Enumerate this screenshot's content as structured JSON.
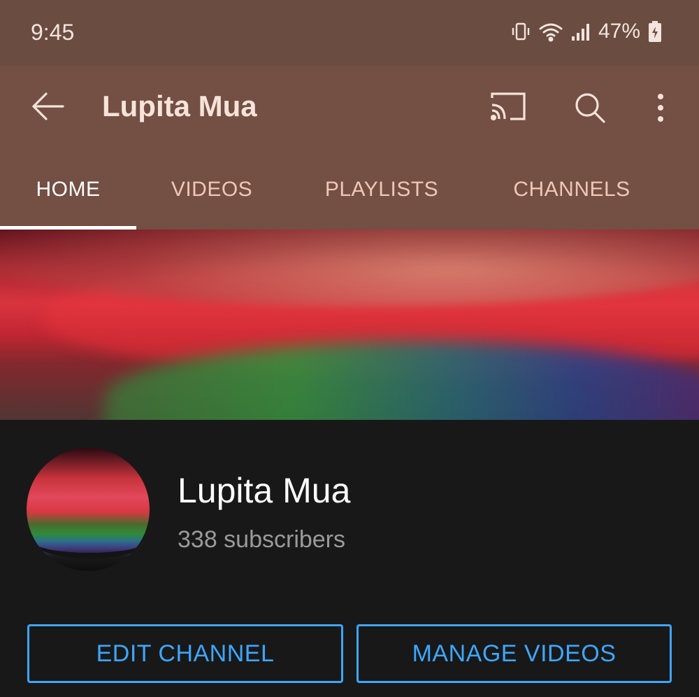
{
  "status_bar": {
    "time": "9:45",
    "battery": "47%"
  },
  "app_bar": {
    "title": "Lupita Mua"
  },
  "tabs": [
    {
      "label": "HOME",
      "active": true
    },
    {
      "label": "VIDEOS",
      "active": false
    },
    {
      "label": "PLAYLISTS",
      "active": false
    },
    {
      "label": "CHANNELS",
      "active": false
    }
  ],
  "channel": {
    "name": "Lupita Mua",
    "subscribers": "338 subscribers"
  },
  "buttons": {
    "edit": "EDIT CHANNEL",
    "manage": "MANAGE VIDEOS"
  },
  "colors": {
    "header": "#734f44",
    "status_bar": "#6b4c40",
    "accent": "#3ea6ff",
    "background": "#181818"
  }
}
